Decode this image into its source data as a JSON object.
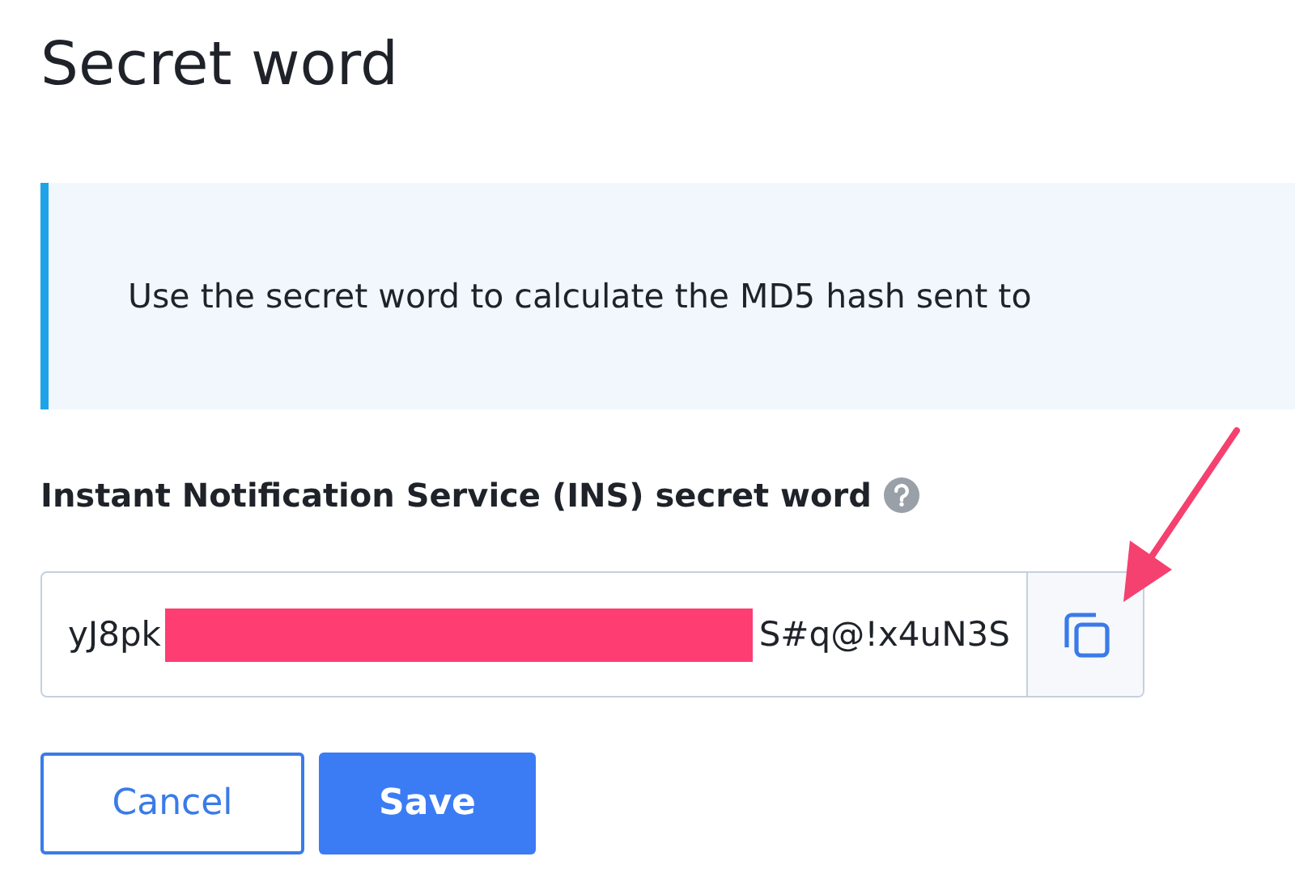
{
  "title": "Secret word",
  "info": {
    "text": "Use the secret word to calculate the MD5 hash sent to"
  },
  "field": {
    "label": "Instant Notification Service (INS) secret word",
    "value_start": "yJ8pk",
    "value_end": "S#q@!x4uN3S",
    "redacted": true
  },
  "buttons": [
    {
      "label": "Cancel",
      "kind": "secondary"
    },
    {
      "label": "Save",
      "kind": "primary"
    }
  ],
  "annotation": {
    "kind": "arrow"
  }
}
